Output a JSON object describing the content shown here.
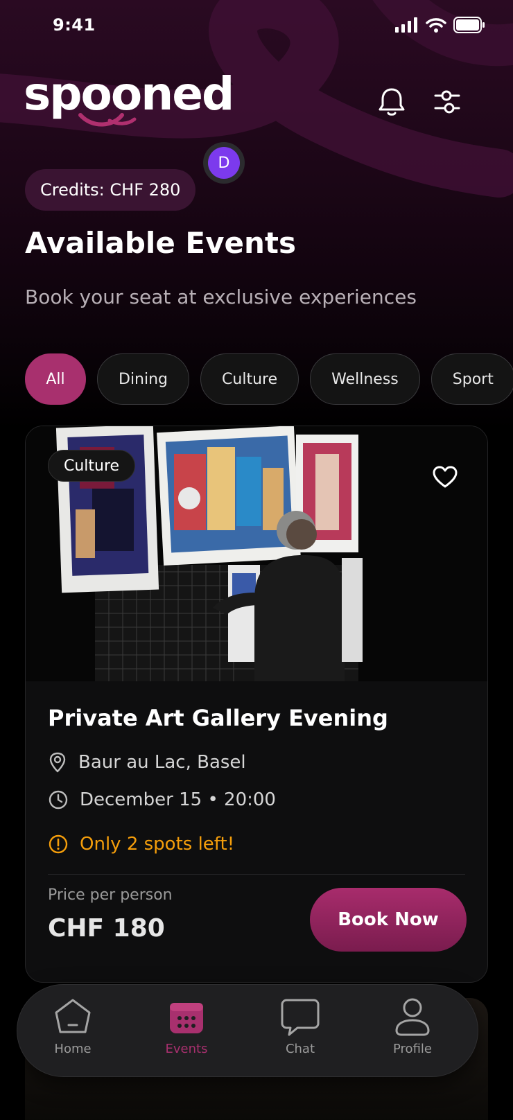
{
  "status": {
    "time": "9:41"
  },
  "header": {
    "logo_text": "spooned",
    "avatar_initial": "D",
    "credits": "Credits: CHF 280"
  },
  "page": {
    "title": "Available Events",
    "subtitle": "Book your seat at exclusive experiences"
  },
  "filters": [
    {
      "label": "All",
      "active": true
    },
    {
      "label": "Dining",
      "active": false
    },
    {
      "label": "Culture",
      "active": false
    },
    {
      "label": "Wellness",
      "active": false
    },
    {
      "label": "Sport",
      "active": false
    }
  ],
  "event": {
    "tag": "Culture",
    "title": "Private Art Gallery Evening",
    "location": "Baur au Lac, Basel",
    "datetime": "December 15 • 20:00",
    "availability": "Only 2 spots left!",
    "price_label": "Price per person",
    "price": "CHF 180",
    "cta": "Book Now"
  },
  "tabs": [
    {
      "label": "Home",
      "icon": "home-icon",
      "active": false
    },
    {
      "label": "Events",
      "icon": "calendar-icon",
      "active": true
    },
    {
      "label": "Chat",
      "icon": "chat-icon",
      "active": false
    },
    {
      "label": "Profile",
      "icon": "profile-icon",
      "active": false
    }
  ],
  "colors": {
    "accent": "#a8306e",
    "warning": "#f59e0b",
    "avatar": "#7c3aed"
  }
}
